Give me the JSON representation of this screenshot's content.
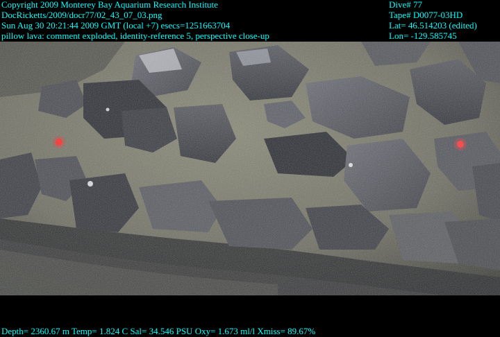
{
  "header_left": {
    "copyright": "Copyright 2009 Monterey Bay Aquarium Research Institute",
    "file": "DocRicketts/2009/docr77/02_43_07_03.png",
    "timestamp": "Sun Aug 30 20:21:44 2009 GMT (local +7)  esecs=1251663704",
    "description": "pillow lava: comment exploded, identity-reference 5, perspective close-up"
  },
  "header_right": {
    "dive": "Dive# 77",
    "tape": "Tape# D0077-03HD",
    "lat": "Lat= 46.514203 (edited)",
    "lon": "Lon= -129.585745"
  },
  "footer": {
    "telemetry": "Depth= 2360.67 m  Temp= 1.824 C  Sal= 34.546 PSU  Oxy= 1.673 ml/l  Xmiss= 89.67%"
  },
  "colors": {
    "overlay_text": "#00ffff",
    "background": "#000000",
    "laser_dot": "#ff2a2a"
  }
}
